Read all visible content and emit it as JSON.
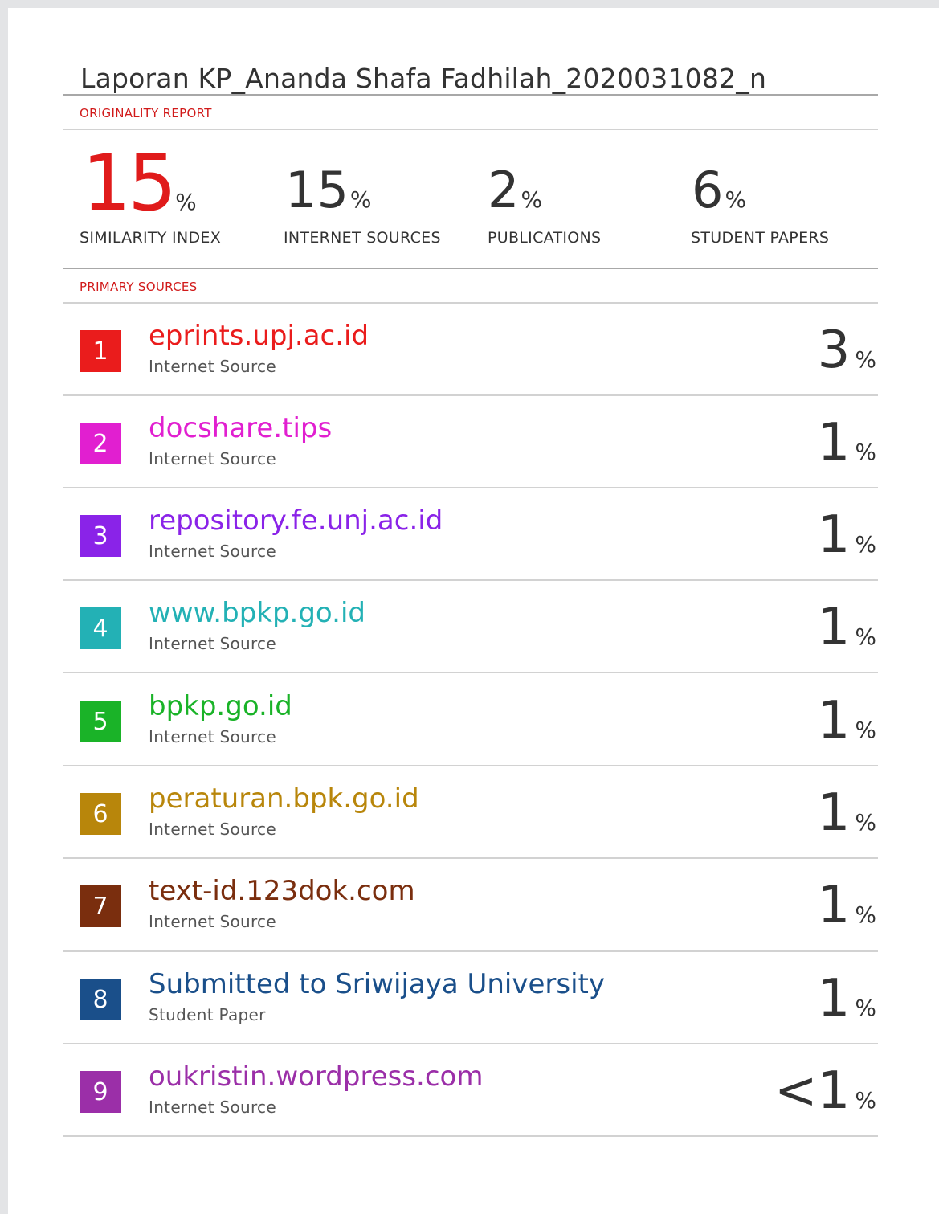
{
  "document": {
    "title": "Laporan KP_Ananda Shafa Fadhilah_2020031082_n"
  },
  "originality_report": {
    "label": "ORIGINALITY REPORT",
    "accent_color": "#e01b1b",
    "stats": [
      {
        "value": "15",
        "unit": "%",
        "label": "SIMILARITY INDEX"
      },
      {
        "value": "15",
        "unit": "%",
        "label": "INTERNET SOURCES"
      },
      {
        "value": "2",
        "unit": "%",
        "label": "PUBLICATIONS"
      },
      {
        "value": "6",
        "unit": "%",
        "label": "STUDENT PAPERS"
      }
    ]
  },
  "primary_sources": {
    "label": "PRIMARY SOURCES",
    "items": [
      {
        "rank": "1",
        "name": "eprints.upj.ac.id",
        "type": "Internet Source",
        "share": "3",
        "unit": "%",
        "color": "#ea1c1c"
      },
      {
        "rank": "2",
        "name": "docshare.tips",
        "type": "Internet Source",
        "share": "1",
        "unit": "%",
        "color": "#e11fd0"
      },
      {
        "rank": "3",
        "name": "repository.fe.unj.ac.id",
        "type": "Internet Source",
        "share": "1",
        "unit": "%",
        "color": "#8a23e8"
      },
      {
        "rank": "4",
        "name": "www.bpkp.go.id",
        "type": "Internet Source",
        "share": "1",
        "unit": "%",
        "color": "#23b1b5"
      },
      {
        "rank": "5",
        "name": "bpkp.go.id",
        "type": "Internet Source",
        "share": "1",
        "unit": "%",
        "color": "#1ab328"
      },
      {
        "rank": "6",
        "name": "peraturan.bpk.go.id",
        "type": "Internet Source",
        "share": "1",
        "unit": "%",
        "color": "#b8860b"
      },
      {
        "rank": "7",
        "name": "text-id.123dok.com",
        "type": "Internet Source",
        "share": "1",
        "unit": "%",
        "color": "#7a2e0e"
      },
      {
        "rank": "8",
        "name": "Submitted to Sriwijaya University",
        "type": "Student Paper",
        "share": "1",
        "unit": "%",
        "color": "#1a4f8a"
      },
      {
        "rank": "9",
        "name": "oukristin.wordpress.com",
        "type": "Internet Source",
        "share": "<1",
        "unit": "%",
        "color": "#9b2fa8"
      }
    ]
  }
}
